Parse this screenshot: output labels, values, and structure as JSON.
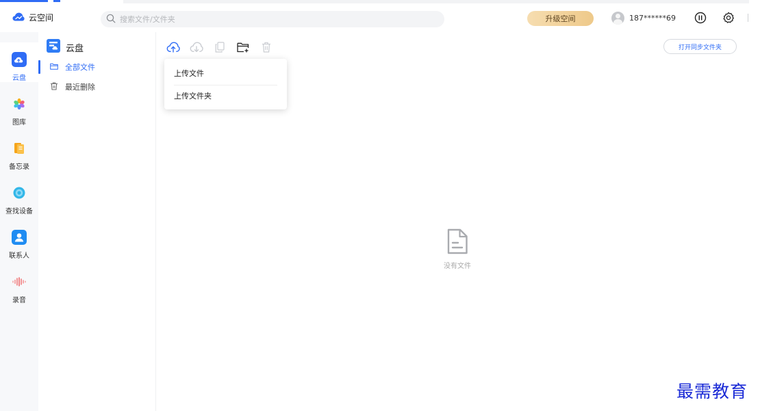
{
  "brand": {
    "name": "云空间"
  },
  "search": {
    "placeholder": "搜索文件/文件夹"
  },
  "header": {
    "upgrade_label": "升级空间",
    "user_phone": "187******69"
  },
  "nav": {
    "items": [
      {
        "label": "云盘",
        "icon": "cloud-disk-icon",
        "active": true
      },
      {
        "label": "图库",
        "icon": "gallery-icon"
      },
      {
        "label": "备忘录",
        "icon": "notes-icon"
      },
      {
        "label": "查找设备",
        "icon": "find-device-icon"
      },
      {
        "label": "联系人",
        "icon": "contacts-icon"
      },
      {
        "label": "录音",
        "icon": "recorder-icon"
      }
    ]
  },
  "sidebar": {
    "title": "云盘",
    "items": [
      {
        "label": "全部文件",
        "icon": "folder-icon",
        "active": true
      },
      {
        "label": "最近删除",
        "icon": "trash-icon"
      }
    ]
  },
  "toolbar": {
    "sync_label": "打开同步文件夹"
  },
  "upload_menu": {
    "items": [
      {
        "label": "上传文件"
      },
      {
        "label": "上传文件夹"
      }
    ]
  },
  "empty_state": {
    "label": "没有文件"
  },
  "watermark": {
    "text": "最需教育"
  },
  "colors": {
    "accent": "#2f6cf5",
    "upgrade_gradient_start": "#f6ddb0",
    "upgrade_gradient_end": "#eec98a"
  }
}
